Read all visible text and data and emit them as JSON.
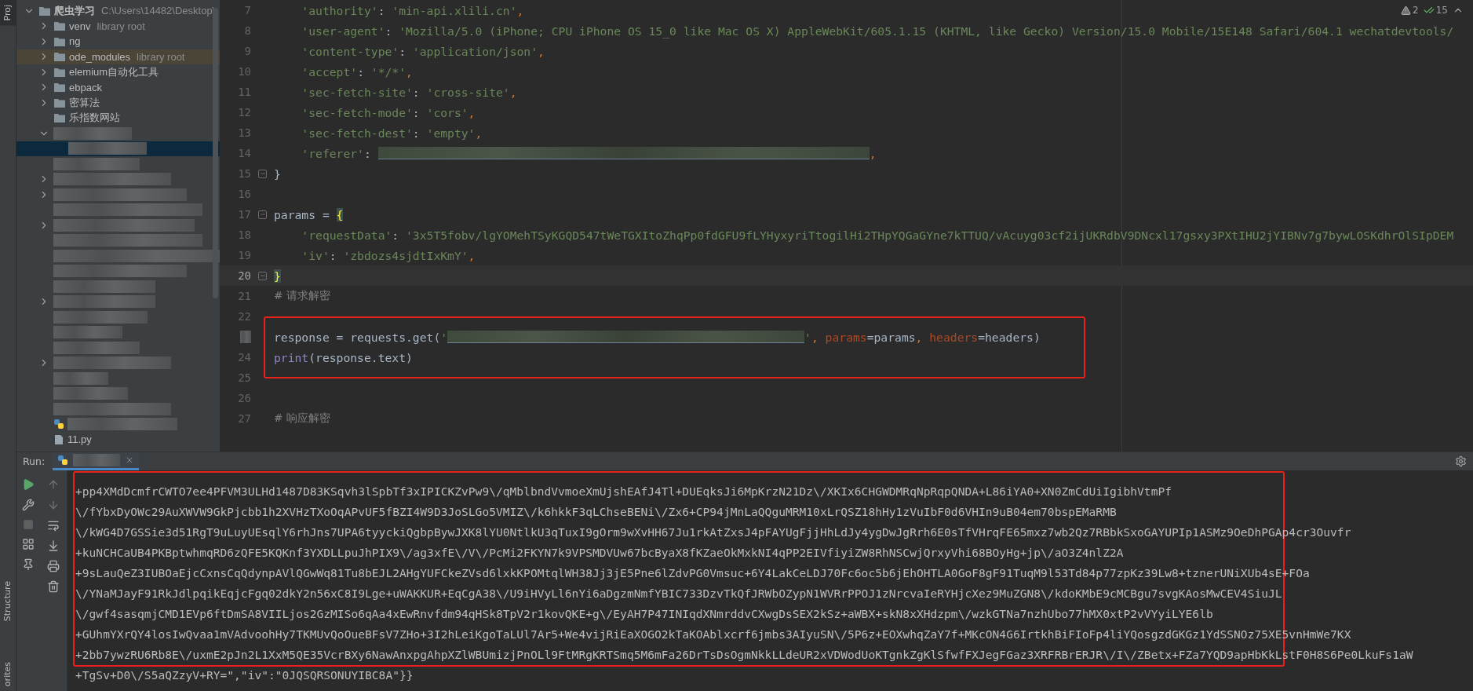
{
  "tool_strip": {
    "top": [
      {
        "label": "Proj",
        "selected": true
      }
    ],
    "bottom": [
      {
        "label": "Structure",
        "selected": false
      },
      {
        "label": "orites",
        "selected": false
      }
    ]
  },
  "project_tree": {
    "root": {
      "label": "爬虫学习",
      "path": "C:\\Users\\14482\\Desktop\\",
      "expanded": true,
      "children": [
        {
          "kind": "folder",
          "label": "venv",
          "note": "library root",
          "expanded": false,
          "selected": false,
          "highlighted": false
        },
        {
          "kind": "folder",
          "label": "ng",
          "expanded": false,
          "selected": false,
          "highlighted": false
        },
        {
          "kind": "folder",
          "label": "ode_modules",
          "note": "library root",
          "expanded": false,
          "selected": false,
          "highlighted": true
        },
        {
          "kind": "folder",
          "label": "elemium自动化工具",
          "expanded": false,
          "selected": false,
          "highlighted": false
        },
        {
          "kind": "folder",
          "label": "ebpack",
          "expanded": false,
          "selected": false,
          "highlighted": false
        },
        {
          "kind": "folder",
          "label": "密算法",
          "expanded": false,
          "selected": false,
          "highlighted": false
        },
        {
          "kind": "folder",
          "label": "乐指数网站",
          "selected": false,
          "highlighted": false
        },
        {
          "kind": "redacted",
          "expanded": true,
          "selected": false,
          "highlighted": false,
          "children": [
            {
              "kind": "redacted",
              "selected": true,
              "highlighted": false
            }
          ]
        },
        {
          "kind": "redacted",
          "selected": false,
          "highlighted": false
        },
        {
          "kind": "redacted",
          "expanded": false,
          "selected": false,
          "highlighted": false
        },
        {
          "kind": "redacted",
          "expanded": false,
          "selected": false,
          "highlighted": false
        },
        {
          "kind": "redacted",
          "selected": false,
          "highlighted": false
        },
        {
          "kind": "redacted",
          "expanded": false,
          "selected": false,
          "highlighted": false
        },
        {
          "kind": "redacted",
          "selected": false,
          "highlighted": false
        },
        {
          "kind": "redacted",
          "selected": false,
          "highlighted": false
        },
        {
          "kind": "redacted",
          "selected": false,
          "highlighted": false
        },
        {
          "kind": "redacted",
          "selected": false,
          "highlighted": false
        },
        {
          "kind": "redacted",
          "expanded": false,
          "selected": false,
          "highlighted": false
        },
        {
          "kind": "redacted",
          "selected": false,
          "highlighted": false
        },
        {
          "kind": "redacted",
          "selected": false,
          "highlighted": false
        },
        {
          "kind": "redacted",
          "selected": false,
          "highlighted": false
        },
        {
          "kind": "redacted",
          "expanded": false,
          "selected": false,
          "highlighted": false
        },
        {
          "kind": "redacted",
          "selected": false,
          "highlighted": false
        },
        {
          "kind": "redacted",
          "selected": false,
          "highlighted": false
        },
        {
          "kind": "redacted",
          "selected": false,
          "highlighted": false
        },
        {
          "kind": "file",
          "selected": false,
          "highlighted": false
        },
        {
          "kind": "file",
          "label": "11.py",
          "selected": false,
          "highlighted": false
        }
      ]
    }
  },
  "editor": {
    "inspections": {
      "warnings": "2",
      "checks": "15"
    },
    "annotation_box": true,
    "lines": [
      {
        "num": "7",
        "current": false,
        "tokens": [
          {
            "kind": "str",
            "text": "    'authority'"
          },
          {
            "kind": "text",
            "text": ": "
          },
          {
            "kind": "str",
            "text": "'min-api.xlili.cn'"
          },
          {
            "kind": "comma",
            "text": ","
          }
        ]
      },
      {
        "num": "8",
        "current": false,
        "tokens": [
          {
            "kind": "str",
            "text": "    'user-agent'"
          },
          {
            "kind": "text",
            "text": ": "
          },
          {
            "kind": "str",
            "text": "'Mozilla/5.0 (iPhone; CPU iPhone OS 15_0 like Mac OS X) AppleWebKit/605.1.15 (KHTML, like Gecko) Version/15.0 Mobile/15E148 Safari/604.1 wechatdevtools/"
          }
        ]
      },
      {
        "num": "9",
        "current": false,
        "tokens": [
          {
            "kind": "str",
            "text": "    'content-type'"
          },
          {
            "kind": "text",
            "text": ": "
          },
          {
            "kind": "str",
            "text": "'application/json'"
          },
          {
            "kind": "comma",
            "text": ","
          }
        ]
      },
      {
        "num": "10",
        "current": false,
        "tokens": [
          {
            "kind": "str",
            "text": "    'accept'"
          },
          {
            "kind": "text",
            "text": ": "
          },
          {
            "kind": "str",
            "text": "'*/*'"
          },
          {
            "kind": "comma",
            "text": ","
          }
        ]
      },
      {
        "num": "11",
        "current": false,
        "tokens": [
          {
            "kind": "str",
            "text": "    'sec-fetch-site'"
          },
          {
            "kind": "text",
            "text": ": "
          },
          {
            "kind": "str",
            "text": "'cross-site'"
          },
          {
            "kind": "comma",
            "text": ","
          }
        ]
      },
      {
        "num": "12",
        "current": false,
        "tokens": [
          {
            "kind": "str",
            "text": "    'sec-fetch-mode'"
          },
          {
            "kind": "text",
            "text": ": "
          },
          {
            "kind": "str",
            "text": "'cors'"
          },
          {
            "kind": "comma",
            "text": ","
          }
        ]
      },
      {
        "num": "13",
        "current": false,
        "tokens": [
          {
            "kind": "str",
            "text": "    'sec-fetch-dest'"
          },
          {
            "kind": "text",
            "text": ": "
          },
          {
            "kind": "str",
            "text": "'empty'"
          },
          {
            "kind": "comma",
            "text": ","
          }
        ]
      },
      {
        "num": "14",
        "current": false,
        "tokens": [
          {
            "kind": "str",
            "text": "    'referer'"
          },
          {
            "kind": "text",
            "text": ": "
          },
          {
            "kind": "redacted"
          },
          {
            "kind": "comma",
            "text": ","
          }
        ]
      },
      {
        "num": "15",
        "fold": true,
        "current": false,
        "tokens": [
          {
            "kind": "text",
            "text": "}"
          }
        ]
      },
      {
        "num": "16",
        "current": false
      },
      {
        "num": "17",
        "fold": true,
        "current": false,
        "tokens": [
          {
            "kind": "text",
            "text": "params = "
          },
          {
            "kind": "brace",
            "text": "{"
          }
        ]
      },
      {
        "num": "18",
        "current": false,
        "tokens": [
          {
            "kind": "str",
            "text": "    'requestData'"
          },
          {
            "kind": "text",
            "text": ": "
          },
          {
            "kind": "str",
            "text": "'3x5T5fobv/lgYOMehTSyKGQD547tWeTGXItoZhqPp0fdGFU9fLYHyxyriTtogilHi2THpYQGaGYne7kTTUQ/vAcuyg03cf2ijUKRdbV9DNcxl17gsxy3PXtIHU2jYIBNv7g7bywLOSKdhrOlSIpDEM"
          }
        ]
      },
      {
        "num": "19",
        "current": false,
        "tokens": [
          {
            "kind": "str",
            "text": "    'iv'"
          },
          {
            "kind": "text",
            "text": ": "
          },
          {
            "kind": "str",
            "text": "'zbdozs4sjdtIxKmY'"
          },
          {
            "kind": "comma",
            "text": ","
          }
        ]
      },
      {
        "num": "20",
        "fold": true,
        "current": true,
        "tokens": [
          {
            "kind": "brace",
            "text": "}"
          }
        ]
      },
      {
        "num": "21",
        "current": false,
        "tokens": [
          {
            "kind": "comment",
            "text": "# 请求解密"
          }
        ]
      },
      {
        "num": "22",
        "current": false
      },
      {
        "current": false,
        "tokens": [
          {
            "kind": "text",
            "text": "response = requests.get("
          },
          {
            "kind": "str",
            "text": "'"
          },
          {
            "kind": "redacted"
          },
          {
            "kind": "str",
            "text": "'"
          },
          {
            "kind": "comma",
            "text": ", "
          },
          {
            "kind": "kwarg",
            "text": "params"
          },
          {
            "kind": "text",
            "text": "=params"
          },
          {
            "kind": "comma",
            "text": ", "
          },
          {
            "kind": "kwarg",
            "text": "headers"
          },
          {
            "kind": "text",
            "text": "=headers)"
          }
        ]
      },
      {
        "num": "24",
        "current": false,
        "tokens": [
          {
            "kind": "builtin",
            "text": "print"
          },
          {
            "kind": "text",
            "text": "(response.text)"
          }
        ]
      },
      {
        "num": "25",
        "current": false
      },
      {
        "num": "26",
        "current": false
      },
      {
        "num": "27",
        "current": false,
        "tokens": [
          {
            "kind": "comment",
            "text": "# 响应解密"
          }
        ]
      }
    ]
  },
  "run_panel": {
    "label": "Run:",
    "annotation_box": true,
    "output": [
      "+pp4XMdDcmfrCWTO7ee4PFVM3ULHd1487D83KSqvh3lSpbTf3xIPICKZvPw9\\/qMblbndVvmoeXmUjshEAfJ4Tl+DUEqksJi6MpKrzN21Dz\\/XKIx6CHGWDMRqNpRqpQNDA+L86iYA0+XN0ZmCdUiIgibhVtmPf",
      "\\/fYbxDyOWc29AuXWVW9GkPjcbb1h2XVHzTXoOqAPvUF5fBZI4W9D3JoSLGo5VMIZ\\/k6hkkF3qLChseBENi\\/Zx6+CP94jMnLaQQguMRM10xLrQSZ18hHy1zVuIbF0d6VHIn9uB04em70bspEMaRMB",
      "\\/kWG4D7GSSie3d51RgT9uLuyUEsqlY6rhJns7UPA6tyyckiQgbpBywJXK8lYU0NtlkU3qTuxI9gOrm9wXvHH67Ju1rkAtZxsJ4pFAYUgFjjHhLdJy4ygDwJgRrh6E0sTfVHrqFE65mxz7wb2Qz7RBbkSxoGAYUPIp1ASMz9OeDhPGAp4cr3Ouvfr",
      "+kuNCHCaUB4PKBptwhmqRD6zQFE5KQKnf3YXDLLpuJhPIX9\\/ag3xfE\\/V\\/PcMi2FKYN7k9VPSMDVUw67bcByaX8fKZaeOkMxkNI4qPP2EIVfiyiZW8RhNSCwjQrxyVhi68BOyHg+jp\\/aO3Z4nlZ2A",
      "+9sLauQeZ3IUBOaEjcCxnsCqQdynpAVlQGwWq81Tu8bEJL2AHgYUFCkeZVsd6lxkKPOMtqlWH38Jj3jE5Pne6lZdvPG0Vmsuc+6Y4LakCeLDJ70Fc6oc5b6jEhOHTLA0GoF8gF91TuqM9l53Td84p77zpKz39Lw8+tznerUNiXUb4sE+FOa",
      "\\/YNaMJayF91RkJdlpqikEqjcFgq02dkY2n56xC8I9Lge+uWAKKUR+EqCgA38\\/U9iHVyLl6nYi6aDgzmNmfYBIC733DzvTkQfJRWbOZypN1WVRrPPOJ1zNrcvaIeRYHjcXez9MuZGN8\\/kdoKMbE9cMCBgu7svgKAosMwCEV4SiuJL",
      "\\/gwf4sasqmjCMD1EVp6ftDmSA8VIILjos2GzMISo6qAa4xEwRnvfdm94qHSk8TpV2r1kovQKE+g\\/EyAH7P47INIqdXNmrddvCXwgDsSEX2kSz+aWBX+skN8xXHdzpm\\/wzkGTNa7nzhUbo77hMX0xtP2vVYyiLYE6lb",
      "+GUhmYXrQY4losIwQvaa1mVAdvoohHy7TKMUvQoOueBFsV7ZHo+3I2hLeiKgoTaLUl7Ar5+We4vijRiEaXOGO2kTaKOAblxcrf6jmbs3AIyuSN\\/5P6z+EOXwhqZaY7f+MKcON4G6IrtkhBiFIoFp4liYQosgzdGKGz1YdSSNOz75XE5vnHmWe7KX",
      "+2bb7ywzRU6Rb8E\\/uxmE2pJn2L1XxM5QE35VcrBXy6NawAnxpgAhpXZlWBUmizjPnOLl9FtMRgKRTSmq5M6mFa26DrTsDsOgmNkkLLdeUR2xVDWodUoKTgnkZgKlSfwfFXJegFGaz3XRFRBrERJR\\/I\\/ZBetx+FZa7YQD9apHbKkLstF0H8S6Pe0LkuFs1aW",
      "+TgSv+D0\\/S5aQZzyV+RY=\",\"iv\":\"0JQSQRSONUYIBC8A\"}}"
    ]
  }
}
